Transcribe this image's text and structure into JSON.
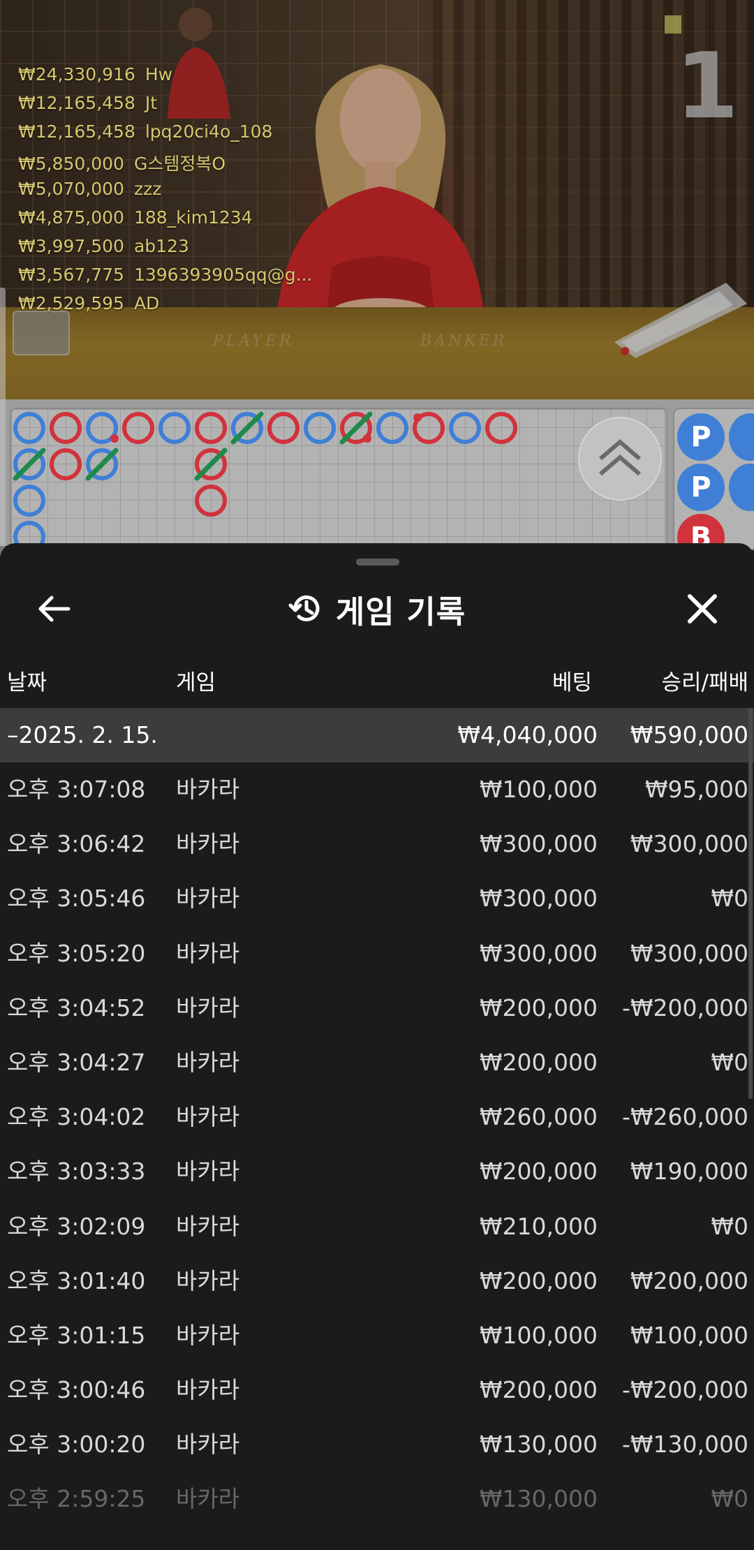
{
  "top_winners": [
    {
      "amount": "₩24,330,916",
      "name": "Hw"
    },
    {
      "amount": "₩12,165,458",
      "name": "Jt"
    },
    {
      "amount": "₩12,165,458",
      "name": "lpq20ci4o_108"
    },
    {
      "amount": "₩5,850,000",
      "name": "G스템정복O"
    },
    {
      "amount": "₩5,070,000",
      "name": "zzz"
    },
    {
      "amount": "₩4,875,000",
      "name": "188_kim1234"
    },
    {
      "amount": "₩3,997,500",
      "name": "ab123"
    },
    {
      "amount": "₩3,567,775",
      "name": "1396393905qq@g..."
    },
    {
      "amount": "₩2,529,595",
      "name": "AD"
    }
  ],
  "video": {
    "round_number": "1",
    "table_player_label": "PLAYER",
    "table_banker_label": "BANKER"
  },
  "bead_road": [
    "P",
    "P",
    "B"
  ],
  "colors": {
    "player": "#3f7fd6",
    "banker": "#d0333b",
    "tie": "#1f8a4a",
    "sheet_bg": "#1b1b1b",
    "summary_bg": "#3c3c3c"
  },
  "history": {
    "title": "게임 기록",
    "columns": {
      "date": "날짜",
      "game": "게임",
      "bet": "베팅",
      "win_loss": "승리/패배"
    },
    "summary": {
      "date": "–2025. 2. 15.",
      "bet": "₩4,040,000",
      "win_loss": "₩590,000"
    },
    "rows": [
      {
        "time": "오후 3:07:08",
        "game": "바카라",
        "bet": "₩100,000",
        "win_loss": "₩95,000"
      },
      {
        "time": "오후 3:06:42",
        "game": "바카라",
        "bet": "₩300,000",
        "win_loss": "₩300,000"
      },
      {
        "time": "오후 3:05:46",
        "game": "바카라",
        "bet": "₩300,000",
        "win_loss": "₩0"
      },
      {
        "time": "오후 3:05:20",
        "game": "바카라",
        "bet": "₩300,000",
        "win_loss": "₩300,000"
      },
      {
        "time": "오후 3:04:52",
        "game": "바카라",
        "bet": "₩200,000",
        "win_loss": "-₩200,000"
      },
      {
        "time": "오후 3:04:27",
        "game": "바카라",
        "bet": "₩200,000",
        "win_loss": "₩0"
      },
      {
        "time": "오후 3:04:02",
        "game": "바카라",
        "bet": "₩260,000",
        "win_loss": "-₩260,000"
      },
      {
        "time": "오후 3:03:33",
        "game": "바카라",
        "bet": "₩200,000",
        "win_loss": "₩190,000"
      },
      {
        "time": "오후 3:02:09",
        "game": "바카라",
        "bet": "₩210,000",
        "win_loss": "₩0"
      },
      {
        "time": "오후 3:01:40",
        "game": "바카라",
        "bet": "₩200,000",
        "win_loss": "₩200,000"
      },
      {
        "time": "오후 3:01:15",
        "game": "바카라",
        "bet": "₩100,000",
        "win_loss": "₩100,000"
      },
      {
        "time": "오후 3:00:46",
        "game": "바카라",
        "bet": "₩200,000",
        "win_loss": "-₩200,000"
      },
      {
        "time": "오후 3:00:20",
        "game": "바카라",
        "bet": "₩130,000",
        "win_loss": "-₩130,000"
      },
      {
        "time": "오후 2:59:25",
        "game": "바카라",
        "bet": "₩130,000",
        "win_loss": "₩0"
      }
    ]
  }
}
